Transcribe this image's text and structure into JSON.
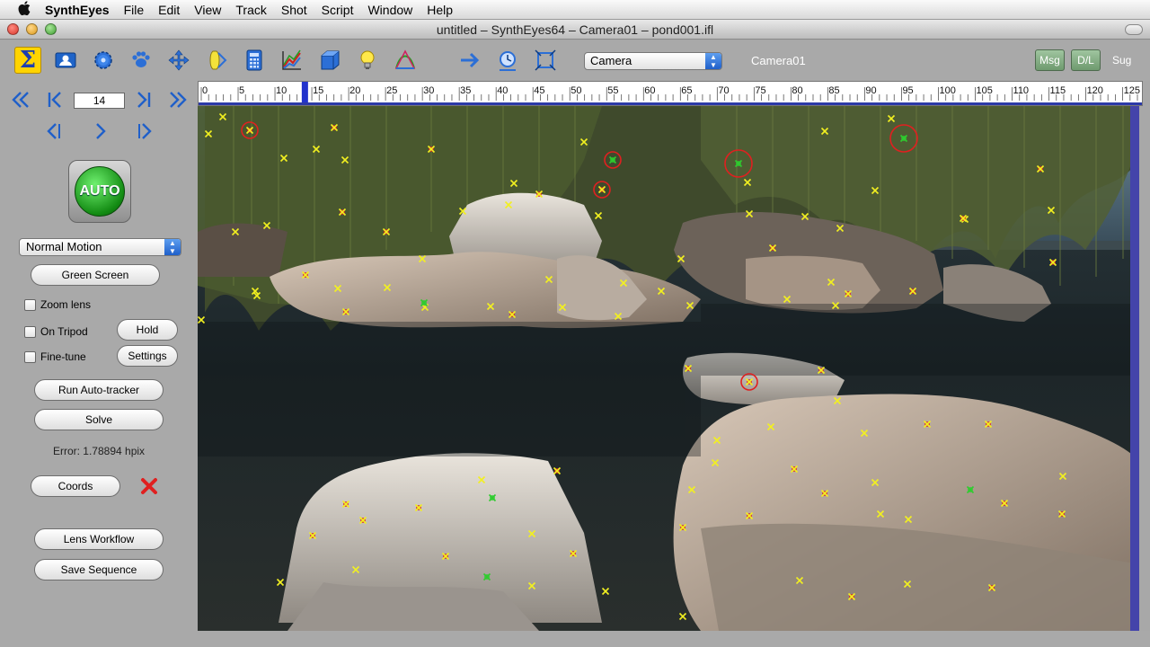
{
  "menubar": {
    "app_name": "SynthEyes",
    "items": [
      "File",
      "Edit",
      "View",
      "Track",
      "Shot",
      "Script",
      "Window",
      "Help"
    ]
  },
  "window": {
    "title": "untitled – SynthEyes64 – Camera01 – pond001.ifl"
  },
  "toolbar": {
    "tools": [
      {
        "name": "summary-icon",
        "glyph": "Σ",
        "active": true
      },
      {
        "name": "shot-icon"
      },
      {
        "name": "gear-icon"
      },
      {
        "name": "paw-icon"
      },
      {
        "name": "move-icon"
      },
      {
        "name": "lens-icon"
      },
      {
        "name": "calculator-icon"
      },
      {
        "name": "graph-icon"
      },
      {
        "name": "cube-icon"
      },
      {
        "name": "lightbulb-icon"
      },
      {
        "name": "curve-icon"
      },
      {
        "name": "arrow-right-icon"
      },
      {
        "name": "clock-icon"
      },
      {
        "name": "crop-icon"
      }
    ],
    "camera_select": "Camera",
    "camera_name": "Camera01",
    "msg_label": "Msg",
    "dl_label": "D/L",
    "sug_label": "Sug"
  },
  "panel": {
    "frame_number": "14",
    "auto_label": "AUTO",
    "motion_select": "Normal Motion",
    "green_screen_label": "Green Screen",
    "zoom_lens_label": "Zoom lens",
    "on_tripod_label": "On Tripod",
    "fine_tune_label": "Fine-tune",
    "hold_label": "Hold",
    "settings_label": "Settings",
    "run_autotracker_label": "Run Auto-tracker",
    "solve_label": "Solve",
    "error_text": "Error: 1.78894 hpix",
    "coords_label": "Coords",
    "lens_workflow_label": "Lens Workflow",
    "save_sequence_label": "Save Sequence"
  },
  "timeline": {
    "labels": [
      "0",
      "5",
      "10",
      "15",
      "20",
      "25",
      "30",
      "35",
      "40",
      "45",
      "50",
      "55",
      "60",
      "65",
      "70",
      "75",
      "80",
      "85",
      "90",
      "95",
      "100",
      "105",
      "110",
      "115",
      "120",
      "125"
    ],
    "current_frame": 14,
    "max_frame": 127
  },
  "colors": {
    "tracker_yellow": "#f2f020",
    "tracker_green": "#2ecc2e",
    "tracker_red": "#e02020",
    "active_tool": "#ffd400"
  }
}
